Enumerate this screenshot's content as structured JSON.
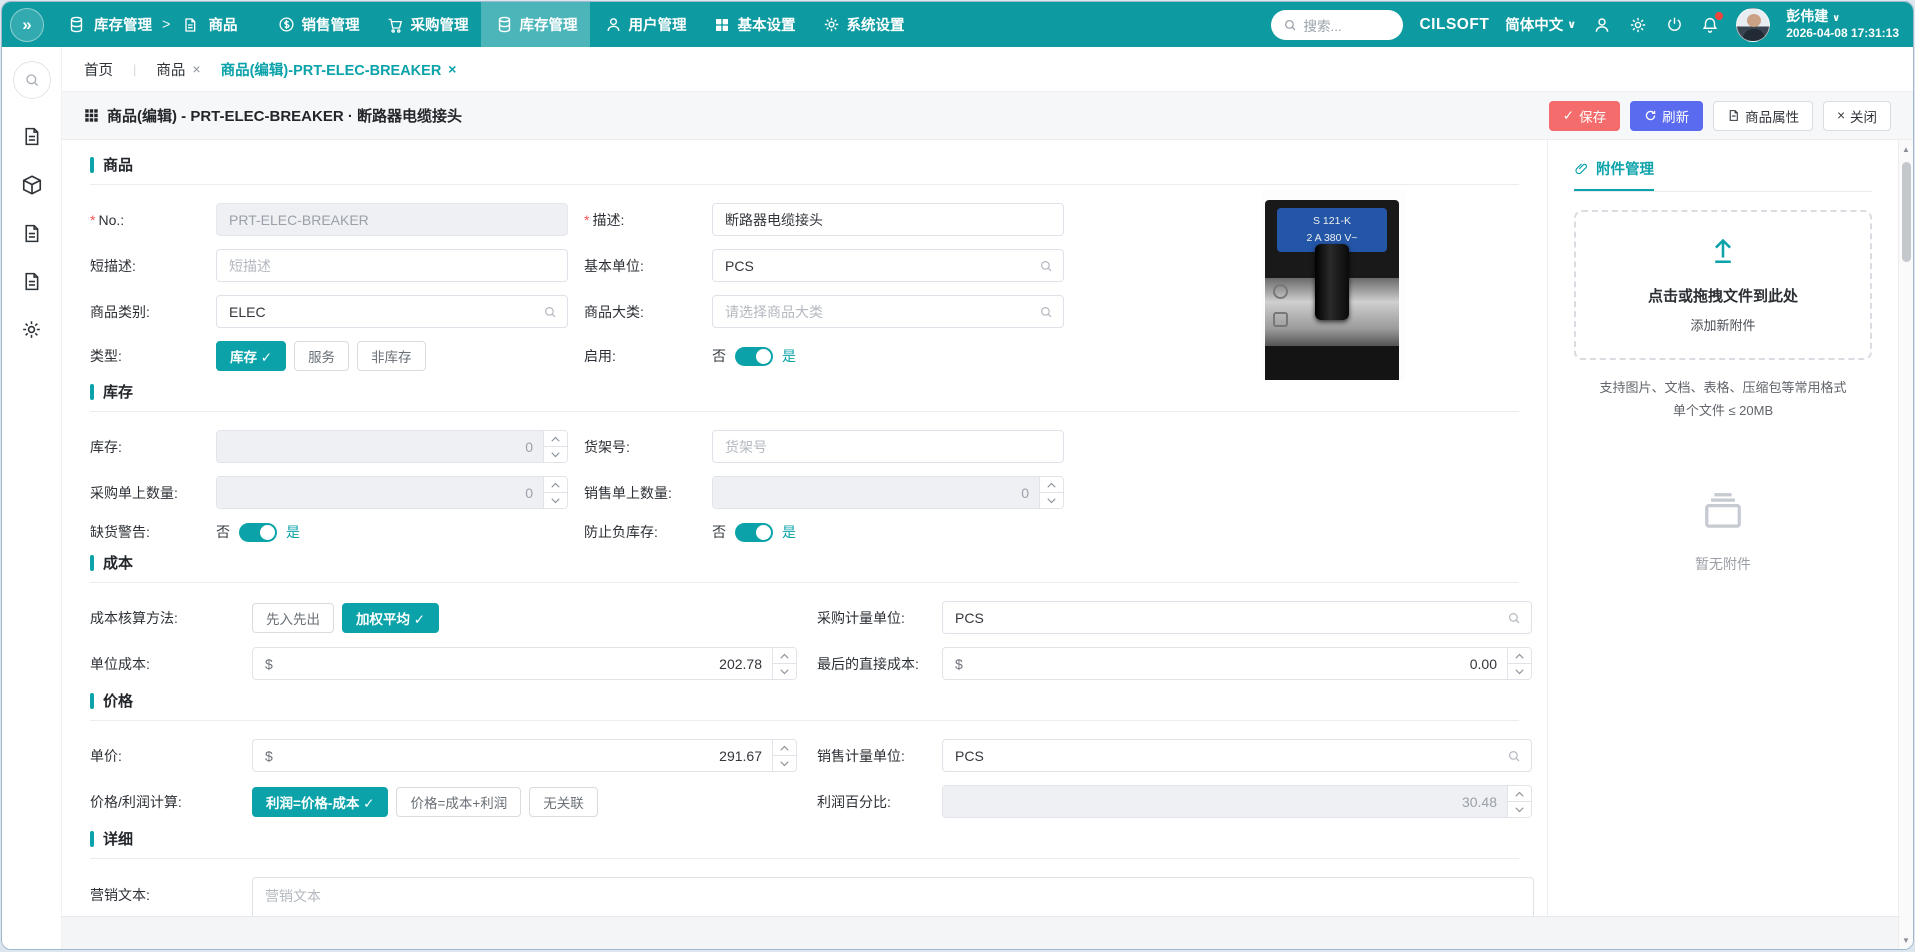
{
  "navbar": {
    "collapse_icon": "»",
    "breadcrumb": {
      "section": "库存管理",
      "separator": ">",
      "page": "商品"
    },
    "menu_items": [
      {
        "label": "销售管理"
      },
      {
        "label": "采购管理"
      },
      {
        "label": "库存管理"
      },
      {
        "label": "用户管理"
      },
      {
        "label": "基本设置"
      },
      {
        "label": "系统设置"
      }
    ],
    "search_placeholder": "搜索...",
    "brand": "CILSOFT",
    "language": "简体中文",
    "chevron": "∨",
    "user_name": "彭伟建",
    "datetime": "2026-04-08 17:31:13"
  },
  "tabs": [
    {
      "label": "首页"
    },
    {
      "label": "商品",
      "close": "×"
    },
    {
      "label": "商品(编辑)-PRT-ELEC-BREAKER",
      "close": "×"
    }
  ],
  "page_header": {
    "title": "商品(编辑) - PRT-ELEC-BREAKER · 断路器电缆接头",
    "save_label": "保存",
    "save_check": "✓",
    "refresh_label": "刷新",
    "attributes_label": "商品属性",
    "close_label": "关闭",
    "close_x": "×"
  },
  "form": {
    "required_mark": "*",
    "no": "否",
    "yes": "是",
    "goods": {
      "title": "商品",
      "no_label": "No.:",
      "no_value": "PRT-ELEC-BREAKER",
      "desc_label": "描述:",
      "desc_value": "断路器电缆接头",
      "short_desc_label": "短描述:",
      "short_desc_placeholder": "短描述",
      "base_unit_label": "基本单位:",
      "base_unit_value": "PCS",
      "category_label": "商品类别:",
      "category_value": "ELEC",
      "class_label": "商品大类:",
      "class_placeholder": "请选择商品大类",
      "type_label": "类型:",
      "type_options": [
        {
          "label": "库存 ✓"
        },
        {
          "label": "服务"
        },
        {
          "label": "非库存"
        }
      ],
      "enabled_label": "启用:"
    },
    "inventory": {
      "title": "库存",
      "stock_label": "库存:",
      "stock_value": "0",
      "shelf_label": "货架号:",
      "shelf_placeholder": "货架号",
      "purchase_qty_label": "采购单上数量:",
      "purchase_qty_value": "0",
      "sales_qty_label": "销售单上数量:",
      "sales_qty_value": "0",
      "oos_warning_label": "缺货警告:",
      "prevent_negative_label": "防止负库存:"
    },
    "cost": {
      "title": "成本",
      "method_label": "成本核算方法:",
      "method_options": [
        {
          "label": "先入先出"
        },
        {
          "label": "加权平均 ✓"
        }
      ],
      "purchase_uom_label": "采购计量单位:",
      "purchase_uom_value": "PCS",
      "unit_cost_label": "单位成本:",
      "currency": "$",
      "unit_cost_value": "202.78",
      "last_cost_label": "最后的直接成本:",
      "last_cost_value": "0.00"
    },
    "price": {
      "title": "价格",
      "unit_price_label": "单价:",
      "unit_price_value": "291.67",
      "sales_uom_label": "销售计量单位:",
      "sales_uom_value": "PCS",
      "calc_label": "价格/利润计算:",
      "calc_options": [
        {
          "label": "利润=价格-成本 ✓"
        },
        {
          "label": "价格=成本+利润"
        },
        {
          "label": "无关联"
        }
      ],
      "profit_pct_label": "利润百分比:",
      "profit_pct_value": "30.48"
    },
    "detail": {
      "title": "详细",
      "marketing_label": "营销文本:",
      "marketing_placeholder": "营销文本"
    }
  },
  "product_image": {
    "line1": "S 121-K",
    "line2": "2 A 380 V~"
  },
  "attachments": {
    "tab": "附件管理",
    "dropzone_title": "点击或拖拽文件到此处",
    "dropzone_subtitle": "添加新附件",
    "hint1": "支持图片、文档、表格、压缩包等常用格式",
    "hint2": "单个文件 ≤ 20MB",
    "empty": "暂无附件"
  },
  "colors": {
    "navbar_teal": "#0d9aa0",
    "accent_teal": "#0ba3a9",
    "save_red": "#f56c6c",
    "refresh_blue": "#5a6bf0"
  }
}
